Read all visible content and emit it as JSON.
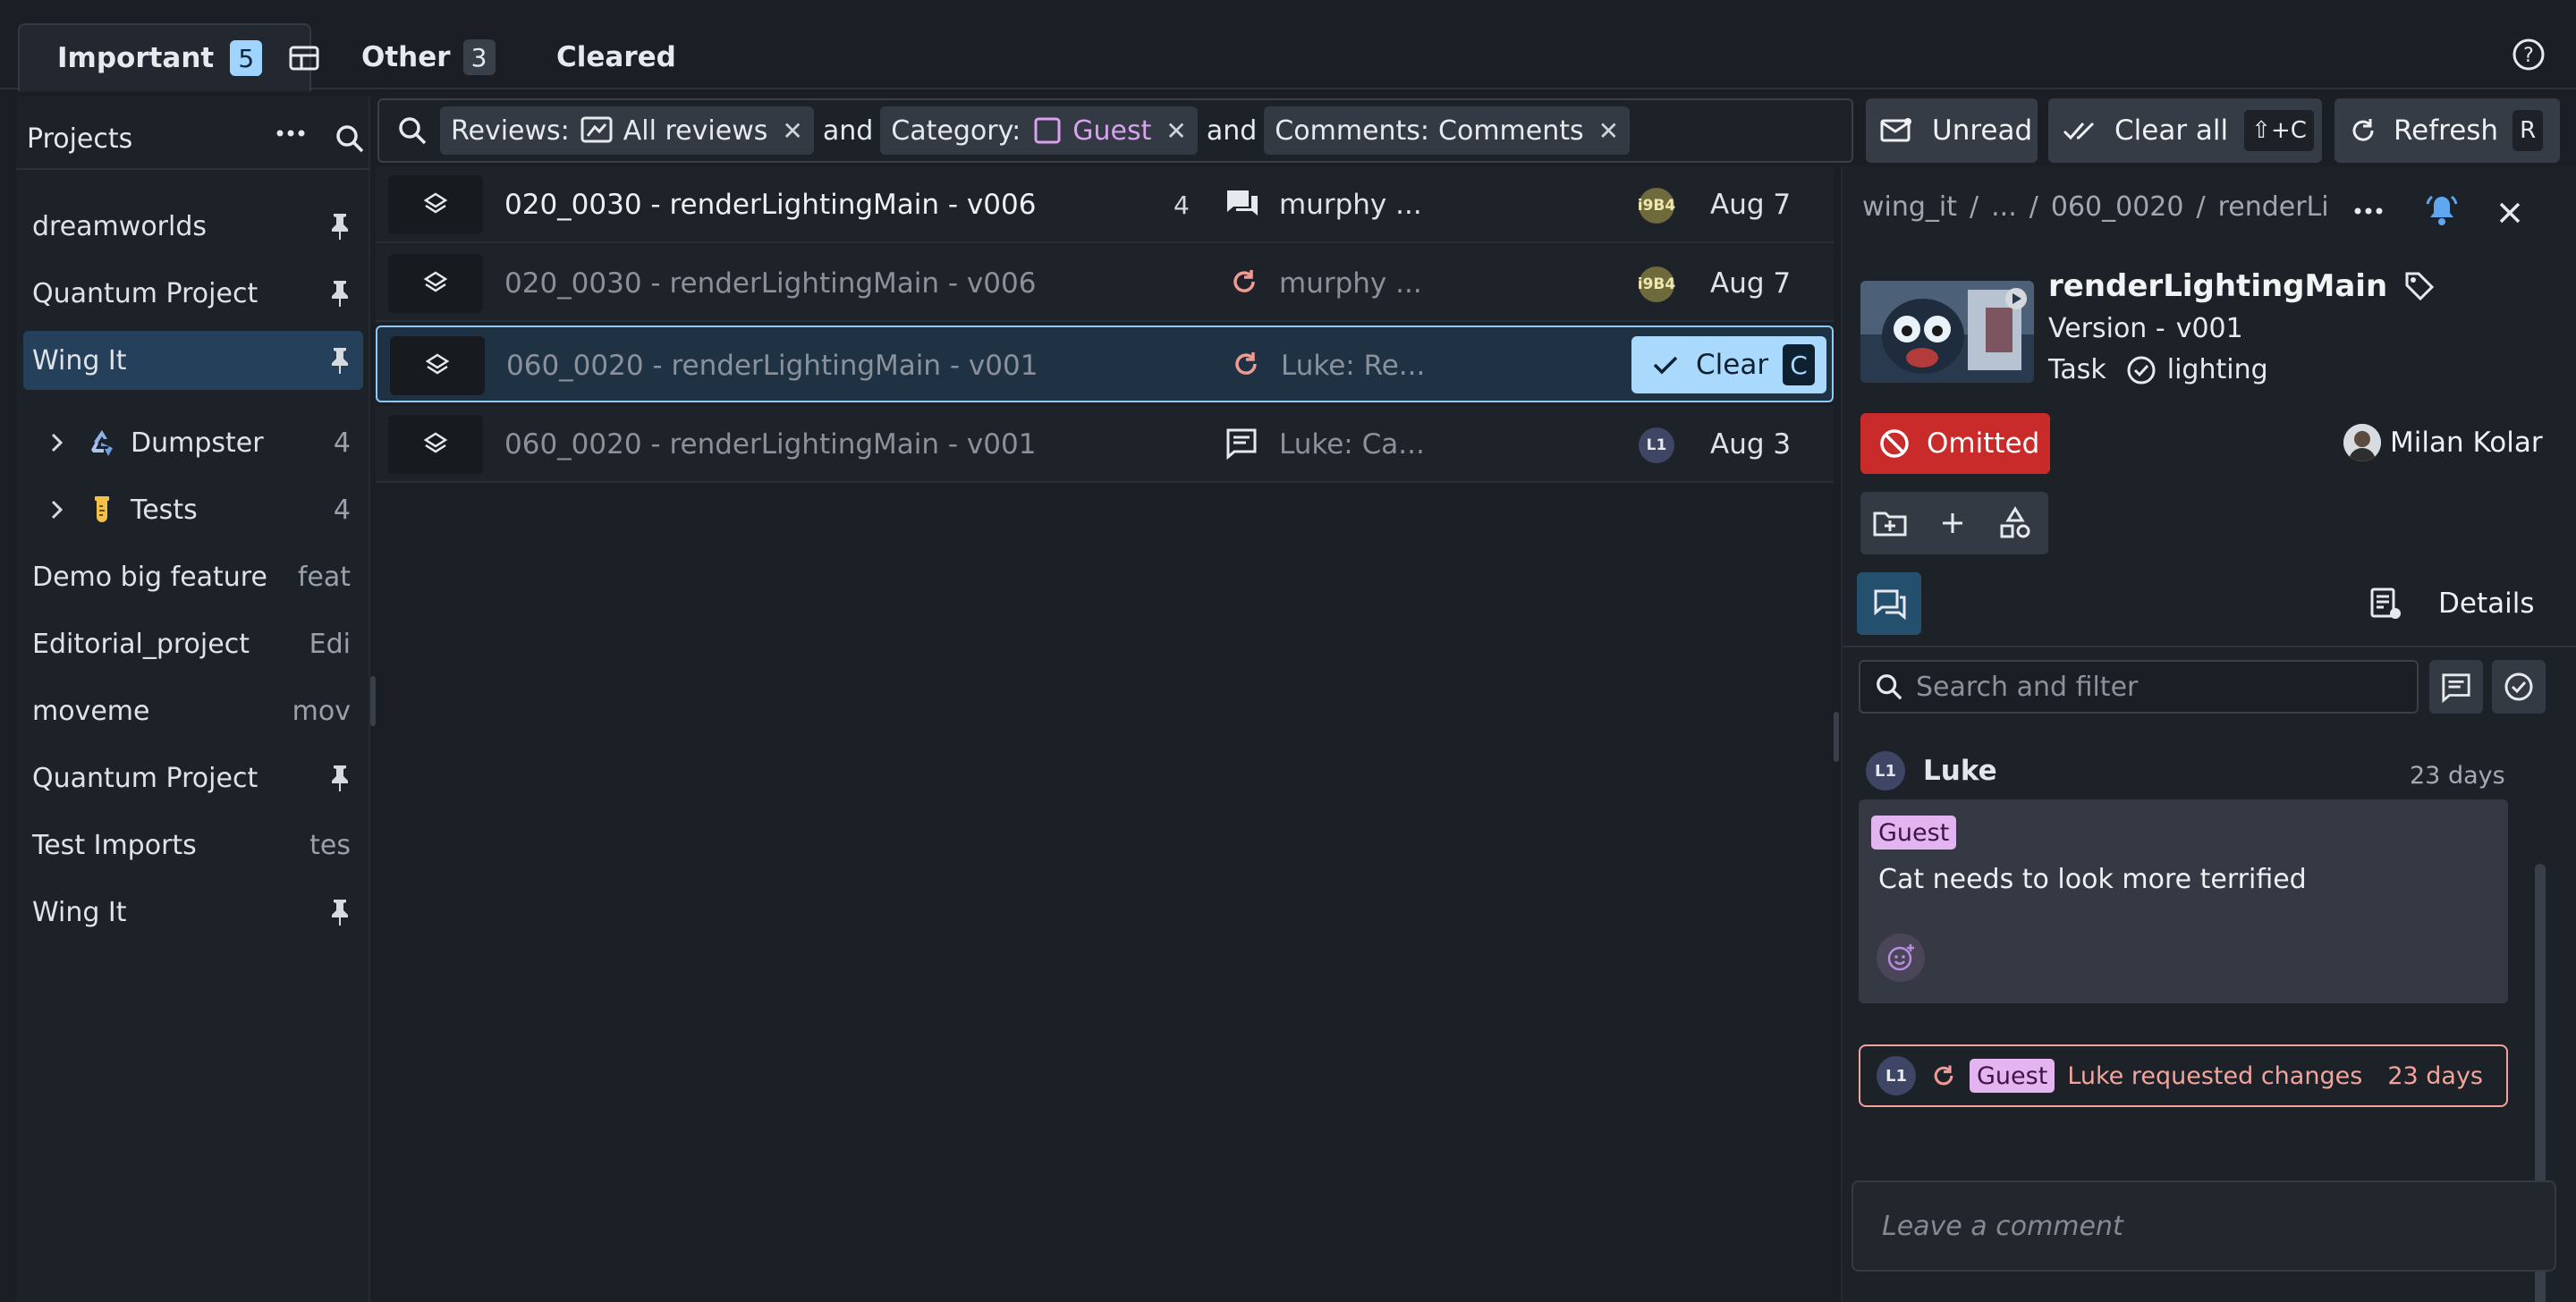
{
  "tabs": [
    {
      "label": "Important",
      "count": "5"
    },
    {
      "label": "Other",
      "count": "3"
    },
    {
      "label": "Cleared"
    }
  ],
  "sidebar": {
    "heading": "Projects",
    "items": [
      {
        "label": "dreamworlds",
        "right": "pin"
      },
      {
        "label": "Quantum Project",
        "right": "pin"
      },
      {
        "label": "Wing It",
        "right": "pin",
        "selected": true
      },
      {
        "label": "Dumpster",
        "right": "4",
        "group": true
      },
      {
        "label": "Tests",
        "right": "4",
        "group": true
      },
      {
        "label": "Demo big feature",
        "right": "feat"
      },
      {
        "label": "Editorial_project",
        "right": "Edi"
      },
      {
        "label": "moveme",
        "right": "mov"
      },
      {
        "label": "Quantum Project",
        "right": "pin"
      },
      {
        "label": "Test Imports",
        "right": "tes"
      },
      {
        "label": "Wing It",
        "right": "pin"
      }
    ]
  },
  "filters": {
    "reviews_key": "Reviews:",
    "reviews_value": "All reviews",
    "and1": "and",
    "category_key": "Category:",
    "category_value": "Guest",
    "and2": "and",
    "comments_key": "Comments:",
    "comments_value": "Comments"
  },
  "toolbar": {
    "unread": "Unread",
    "clear_all": "Clear all",
    "clear_all_kbd": "⇧+C",
    "refresh": "Refresh",
    "refresh_kbd": "R"
  },
  "list": [
    {
      "title": "020_0030 - renderLightingMain - v006",
      "count": "4",
      "icon": "comments-icon",
      "who": "murphy ...",
      "avatar": "i9B4",
      "date": "Aug 7",
      "bright": true
    },
    {
      "title": "020_0030 - renderLightingMain - v006",
      "icon": "refresh-icon",
      "who": "murphy ...",
      "avatar": "i9B4",
      "date": "Aug 7"
    },
    {
      "title": "060_0020 - renderLightingMain - v001",
      "icon": "refresh-icon",
      "who": "Luke: Re...",
      "clear_label": "Clear",
      "clear_kbd": "C",
      "selected": true
    },
    {
      "title": "060_0020 - renderLightingMain - v001",
      "icon": "comment-icon",
      "who": "Luke: Ca...",
      "avatar": "L1",
      "date": "Aug 3"
    }
  ],
  "detail": {
    "breadcrumb": [
      "wing_it",
      "/",
      "...",
      "/",
      "060_0020",
      "/",
      "renderLi"
    ],
    "title": "renderLightingMain",
    "version_label": "Version -",
    "version_value": "v001",
    "task_label": "Task",
    "task_value": "lighting",
    "status": "Omitted",
    "assignee": "Milan Kolar",
    "details_label": "Details",
    "search_placeholder": "Search and filter",
    "comment": {
      "author": "Luke",
      "author_initials": "L1",
      "age": "23 days",
      "tag": "Guest",
      "text": "Cat needs to look more terrified"
    },
    "activity": {
      "initials": "L1",
      "tag": "Guest",
      "text": "Luke requested changes",
      "age": "23 days"
    },
    "leave_comment_placeholder": "Leave a comment"
  },
  "colors": {
    "accent": "#a9dafe",
    "status_omitted": "#c92b2b",
    "guest_tag": "#e4b4f0",
    "selected_row": "#25405a"
  }
}
